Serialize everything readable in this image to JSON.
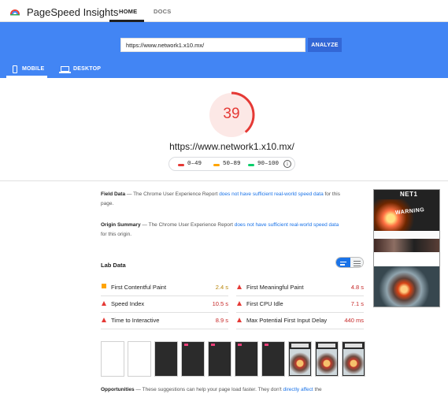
{
  "app": {
    "title": "PageSpeed Insights"
  },
  "nav": {
    "tabs": [
      {
        "label": "HOME",
        "active": true
      },
      {
        "label": "DOCS",
        "active": false
      }
    ]
  },
  "search": {
    "value": "https://www.network1.x10.mx/",
    "button_label": "ANALYZE"
  },
  "device_tabs": [
    {
      "label": "MOBILE",
      "icon": "smartphone-icon",
      "active": true
    },
    {
      "label": "DESKTOP",
      "icon": "desktop-icon",
      "active": false
    }
  ],
  "score": {
    "value": "39",
    "fraction": 0.39,
    "color": "#e53935"
  },
  "tested_url": "https://www.network1.x10.mx/",
  "legend": [
    {
      "label": "0–49",
      "color": "#e53935"
    },
    {
      "label": "50–89",
      "color": "#ffa400"
    },
    {
      "label": "90–100",
      "color": "#0cce6b"
    }
  ],
  "field_data": {
    "title": "Field Data",
    "dash": "—",
    "text_a": "The Chrome User Experience Report",
    "link": "does not have sufficient real-world speed data",
    "text_b": "for this page."
  },
  "origin_summary": {
    "title": "Origin Summary",
    "dash": "—",
    "text_a": "The Chrome User Experience Report",
    "link": "does not have sufficient real-world speed data",
    "text_b": "for this origin."
  },
  "lab_data": {
    "title": "Lab Data",
    "metrics": [
      {
        "label": "First Contentful Paint",
        "value": "2.4 s",
        "status": "average"
      },
      {
        "label": "First Meaningful Paint",
        "value": "4.8 s",
        "status": "fail"
      },
      {
        "label": "Speed Index",
        "value": "10.5 s",
        "status": "fail"
      },
      {
        "label": "First CPU Idle",
        "value": "7.1 s",
        "status": "fail"
      },
      {
        "label": "Time to Interactive",
        "value": "8.9 s",
        "status": "fail"
      },
      {
        "label": "Max Potential First Input Delay",
        "value": "440 ms",
        "status": "fail"
      }
    ]
  },
  "thumbnail": {
    "logo_text": "NET1",
    "banner_text": "WARNING"
  },
  "opportunities": {
    "title": "Opportunities",
    "dash": "—",
    "text": "These suggestions can help your page load faster. They don't",
    "link": "directly affect",
    "tail": "the"
  },
  "colors": {
    "header_blue": "#4285f4",
    "button_blue": "#3367d6",
    "link_blue": "#1a73e8",
    "fail": "#e53935",
    "average": "#ffa400",
    "pass": "#0cce6b"
  }
}
